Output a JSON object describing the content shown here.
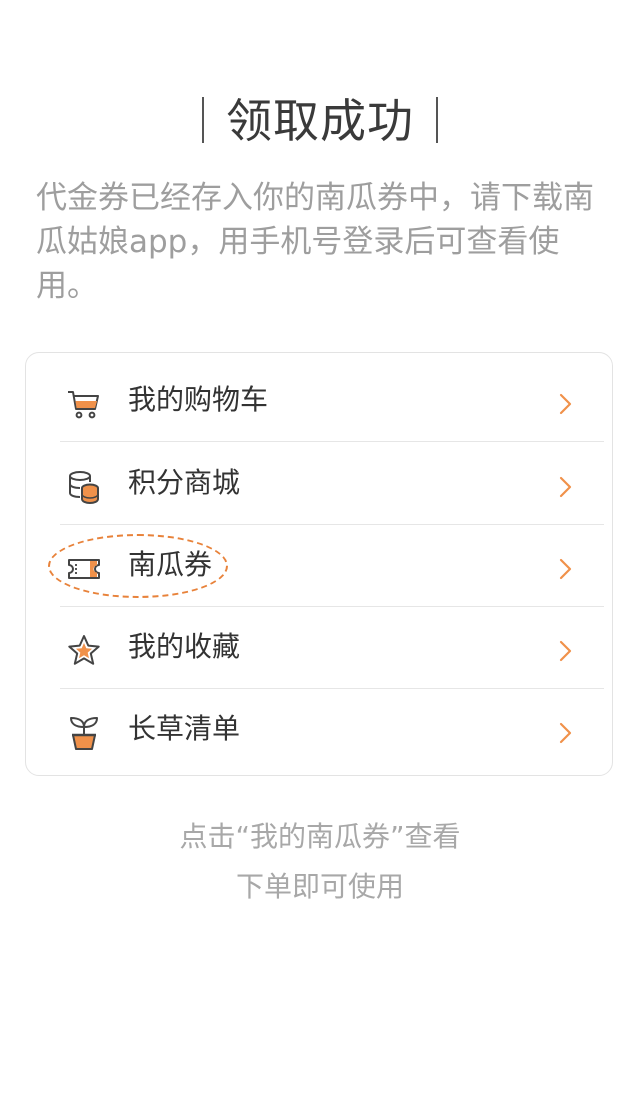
{
  "title": "领取成功",
  "description": "代金券已经存入你的南瓜券中，请下载南瓜姑娘app，用手机号登录后可查看使用。",
  "menu": {
    "items": [
      {
        "label": "我的购物车",
        "icon": "cart-icon"
      },
      {
        "label": "积分商城",
        "icon": "coins-icon"
      },
      {
        "label": "南瓜券",
        "icon": "ticket-icon",
        "highlighted": true
      },
      {
        "label": "我的收藏",
        "icon": "star-icon"
      },
      {
        "label": "长草清单",
        "icon": "sprout-pot-icon"
      }
    ]
  },
  "hint": {
    "line1": "点击“我的南瓜券”查看",
    "line2": "下单即可使用"
  },
  "colors": {
    "accent": "#f0914a",
    "title_text": "#3a3a3a",
    "muted_text": "#9e9e9e",
    "highlight_ring": "#e8823a"
  }
}
